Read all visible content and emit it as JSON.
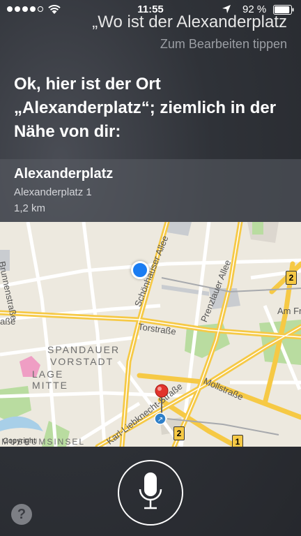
{
  "status_bar": {
    "signal_dots_filled": 4,
    "signal_dots_total": 5,
    "time": "11:55",
    "battery_percent": "92 %",
    "battery_level": 0.92
  },
  "siri": {
    "query": "„Wo ist der Alexanderplatz",
    "edit_hint": "Zum Bearbeiten tippen",
    "response": "Ok, hier ist der Ort „Alexanderplatz“; ziemlich in der Nähe von dir:"
  },
  "place": {
    "name": "Alexanderplatz",
    "address": "Alexanderplatz 1",
    "distance": "1,2 km"
  },
  "map": {
    "labels": {
      "brunnenstrasse": "Brunnenstraße",
      "schoenhauser_allee": "Schönhauser Allee",
      "prenzlauer_allee": "Prenzlauer Allee",
      "torstrasse": "Torstraße",
      "am_fr": "Am Fr",
      "spandauer": "SPANDAUER",
      "vorstadt": "VORSTADT",
      "lage": "LAGE",
      "mitte": "MITTE",
      "mollstrasse": "Mollstraße",
      "karl_liebknecht": "Karl-Liebknecht-Straße",
      "museumsinsel": "MUSEUMSINSEL",
      "asse_left": "aße"
    },
    "route_badges": [
      "2",
      "2",
      "1"
    ],
    "copyright": "Copyright"
  },
  "controls": {
    "help_label": "?"
  },
  "colors": {
    "map_background": "#ede9df",
    "road_yellow": "#f6c945",
    "park_green": "#b9dca0",
    "water_blue": "#a8cfe8",
    "user_location": "#1a7cf2",
    "pin_red": "#e2332c"
  }
}
